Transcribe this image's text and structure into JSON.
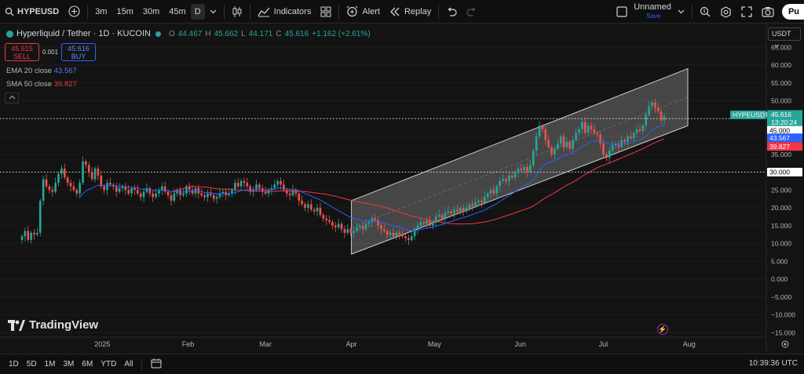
{
  "toolbar": {
    "symbol": "HYPEUSD",
    "timeframes": [
      "3m",
      "15m",
      "30m",
      "45m"
    ],
    "active_timeframe": "D",
    "indicators_label": "Indicators",
    "alert_label": "Alert",
    "replay_label": "Replay",
    "layout_name": "Unnamed",
    "layout_status": "Save",
    "publish_label": "Pu"
  },
  "legend": {
    "title": "Hyperliquid / Tether · 1D · KUCOIN",
    "o": "O",
    "o_val": "44.467",
    "h": "H",
    "h_val": "45.662",
    "l": "L",
    "l_val": "44.171",
    "c": "C",
    "c_val": "45.616",
    "change": "+1.162 (+2.61%)"
  },
  "trade": {
    "sell_price": "45.615",
    "sell_label": "SELL",
    "spread": "0.001",
    "buy_price": "45.616",
    "buy_label": "BUY"
  },
  "indicators": {
    "ema_label": "EMA 20 close",
    "ema_val": "43.567",
    "sma_label": "SMA 50 close",
    "sma_val": "39.827"
  },
  "currency": "USDT",
  "brand": "TradingView",
  "price_axis": {
    "ticks": [
      "65.000",
      "60.000",
      "55.000",
      "50.000",
      "45.000",
      "40.000",
      "35.000",
      "30.000",
      "25.000",
      "20.000",
      "15.000",
      "10.000",
      "5.000",
      "0.000",
      "−5.000",
      "−10.000",
      "−15.000"
    ],
    "tick_values": [
      65,
      60,
      55,
      50,
      45,
      40,
      35,
      30,
      25,
      20,
      15,
      10,
      5,
      0,
      -5,
      -10,
      -15
    ],
    "symbol_tag": "HYPEUSDT",
    "last_price": "45.616",
    "countdown": "13:20:24",
    "hline_upper": "45.000",
    "ema_tag": "43.567",
    "sma_tag": "39.827",
    "hline_lower": "30.000"
  },
  "time_axis": {
    "labels": [
      "2025",
      "Feb",
      "Mar",
      "Apr",
      "May",
      "Jun",
      "Jul",
      "Aug"
    ]
  },
  "bottom": {
    "ranges": [
      "1D",
      "5D",
      "1M",
      "3M",
      "6M",
      "YTD",
      "All"
    ],
    "clock": "10:39:36 UTC"
  },
  "colors": {
    "up": "#26a69a",
    "down": "#ef5350",
    "ema": "#2962ff",
    "sma": "#f23645",
    "bg": "#131313"
  },
  "chart_data": {
    "type": "candlestick",
    "symbol": "HYPEUSDT",
    "exchange": "KUCOIN",
    "interval": "1D",
    "ylim": [
      -15,
      65
    ],
    "x_range": [
      "2024-12-03",
      "2025-07-23"
    ],
    "closes": [
      12.0,
      13.5,
      11.0,
      13.0,
      12.5,
      13.0,
      22.0,
      28.0,
      26.0,
      25.0,
      24.5,
      27.0,
      29.5,
      31.0,
      28.5,
      27.0,
      26.0,
      25.0,
      24.0,
      27.0,
      33.0,
      32.0,
      30.0,
      28.0,
      31.0,
      29.0,
      26.0,
      25.0,
      27.0,
      26.5,
      26.0,
      24.5,
      25.5,
      26.0,
      25.0,
      24.0,
      25.5,
      25.0,
      24.0,
      23.0,
      24.5,
      25.5,
      24.0,
      23.0,
      24.0,
      25.0,
      26.0,
      24.5,
      23.5,
      22.0,
      24.0,
      25.0,
      23.5,
      24.0,
      26.0,
      25.0,
      24.0,
      25.5,
      24.0,
      23.5,
      23.0,
      24.0,
      23.5,
      22.5,
      23.0,
      24.0,
      24.5,
      23.5,
      24.0,
      25.0,
      27.0,
      26.0,
      27.5,
      27.0,
      26.0,
      24.5,
      25.0,
      26.5,
      25.5,
      24.5,
      24.0,
      25.0,
      25.5,
      26.5,
      27.5,
      26.5,
      25.0,
      24.0,
      23.5,
      25.0,
      24.0,
      22.0,
      21.0,
      20.0,
      21.0,
      19.5,
      19.0,
      20.0,
      18.0,
      17.0,
      16.5,
      16.0,
      15.0,
      14.5,
      15.5,
      14.0,
      13.0,
      14.0,
      13.0,
      13.5,
      14.5,
      15.0,
      14.0,
      15.5,
      16.0,
      17.0,
      16.5,
      15.0,
      14.0,
      13.5,
      12.5,
      13.0,
      12.0,
      13.0,
      12.5,
      12.0,
      11.5,
      11.0,
      12.0,
      14.0,
      15.0,
      16.0,
      15.5,
      16.5,
      15.0,
      16.0,
      17.5,
      18.0,
      17.0,
      18.5,
      19.0,
      18.5,
      19.5,
      19.0,
      20.0,
      19.0,
      20.0,
      21.0,
      20.5,
      21.5,
      22.0,
      21.5,
      23.0,
      24.0,
      25.0,
      24.0,
      26.0,
      27.5,
      28.0,
      27.5,
      29.0,
      28.5,
      30.0,
      31.0,
      30.5,
      31.5,
      30.0,
      32.0,
      36.0,
      40.0,
      43.0,
      42.0,
      39.0,
      37.0,
      35.0,
      36.5,
      38.0,
      40.0,
      37.0,
      38.5,
      36.5,
      39.0,
      41.0,
      42.0,
      44.0,
      41.0,
      43.0,
      42.0,
      41.0,
      40.5,
      38.0,
      35.0,
      34.0,
      36.0,
      37.5,
      38.0,
      37.0,
      39.0,
      38.5,
      40.0,
      39.5,
      41.0,
      42.0,
      41.5,
      43.0,
      46.0,
      48.5,
      49.5,
      48.0,
      47.0,
      44.5,
      45.6
    ],
    "ema20": {
      "label": "EMA 20 close",
      "last": 43.567
    },
    "sma50": {
      "label": "SMA 50 close",
      "last": 39.827
    },
    "channel": {
      "start": "2025-04-01",
      "end": "2025-07-23",
      "lower_start": 7,
      "lower_end": 43,
      "upper_start": 22,
      "upper_end": 59
    },
    "hlines": [
      45,
      30
    ]
  }
}
